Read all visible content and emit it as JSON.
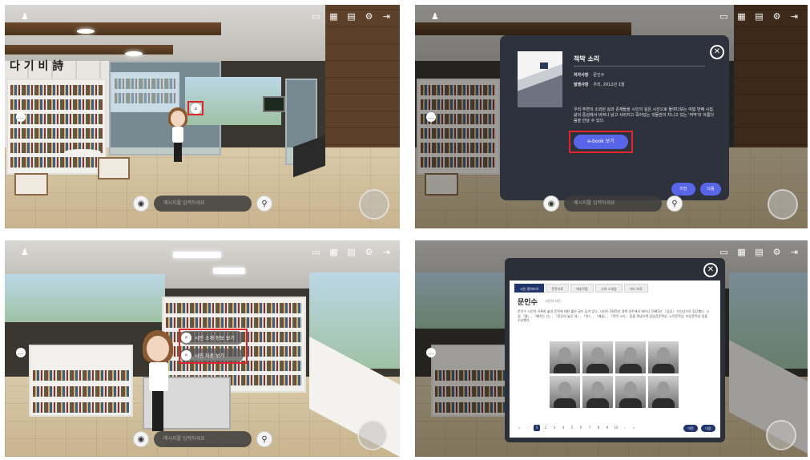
{
  "toolbar": {
    "icons": [
      "home-icon",
      "bookmark-icon",
      "calendar-icon",
      "document-icon",
      "gear-icon",
      "exit-icon"
    ]
  },
  "chat": {
    "placeholder": "메시지를 입력하세요"
  },
  "panel1": {
    "signage": "다 기 비 詩"
  },
  "panel2": {
    "book_title": "적막 소리",
    "author_label": "저자사항",
    "author_value": "문인수",
    "publisher_label": "발행사항",
    "publisher_value": "우리, 2012년 1월",
    "description": "우리 주변의 소외된 삶과 존재들을 시인의 깊은 시선으로 들여다보는 여덟 번째 시집. 삶의 중심에서 비켜나 낡고 사라지고 죽어있는 것들만이 지니고 있는 '적막'의 아름다움을 만날 수 있다.",
    "ebook_button": "e-book 보기",
    "prev_button": "이전",
    "next_button": "다음"
  },
  "panel3": {
    "menu": [
      {
        "label": "시인 소개 정보 보기",
        "icon": "search-icon"
      },
      {
        "label": "시인 자료 보기",
        "icon": "search-icon"
      }
    ]
  },
  "panel4": {
    "tabs": [
      "시인 알아보기",
      "문학자료",
      "애송작품",
      "시와 소개글",
      "기타 자료"
    ],
    "poet_name": "문인수",
    "poet_subtitle": "시인의 사진",
    "bio": "문인수 시인이 기록한 삶과 문학에 대한 짧은 글이 담겨 있다. 시인은 1945년 경북 성주에서 태어나 1985년 『심상』 신인상으로 등단했다. 시집 『뿔』, 『홰치는 산』, 『동강의 높은 새』, 『쉬!』, 『배꼽』, 『적막 소리』 등을 펴냈으며 김달진문학상, 노작문학상, 미당문학상 등을 수상했다.",
    "pages": [
      "«",
      "‹",
      "1",
      "2",
      "3",
      "4",
      "5",
      "6",
      "7",
      "8",
      "9",
      "10",
      "›",
      "»"
    ],
    "prev_button": "이전",
    "next_button": "다음"
  }
}
